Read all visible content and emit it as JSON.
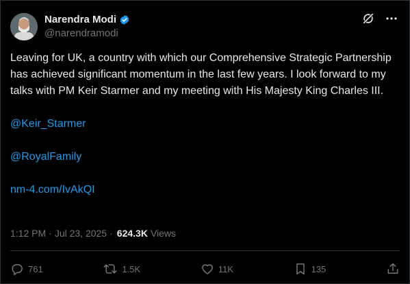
{
  "post": {
    "author": {
      "display_name": "Narendra Modi",
      "handle": "@narendramodi"
    },
    "text": "Leaving for UK, a country with which our Comprehensive Strategic Partnership has achieved significant momentum in the last few years. I look forward to my talks with PM Keir Starmer and my meeting with His Majesty King Charles III.",
    "links": [
      {
        "text": "@Keir_Starmer"
      },
      {
        "text": "@RoyalFamily"
      },
      {
        "text": "nm-4.com/IvAkQI"
      }
    ],
    "meta": {
      "time": "1:12 PM",
      "separator": "·",
      "date": "Jul 23, 2025",
      "separator2": "·",
      "views_count": "624.3K",
      "views_label": "Views"
    },
    "actions": {
      "replies": "761",
      "reposts": "1.5K",
      "likes": "11K",
      "bookmarks": "135"
    }
  },
  "icons": {
    "verified": "verified-badge-icon",
    "grok": "grok-icon",
    "more": "more-icon",
    "reply": "reply-icon",
    "repost": "repost-icon",
    "like": "like-icon",
    "bookmark": "bookmark-icon",
    "share": "share-icon"
  },
  "colors": {
    "background": "#000000",
    "text": "#e7e9ea",
    "muted": "#71767b",
    "link": "#1d9bf0",
    "verified": "#1d9bf0"
  }
}
